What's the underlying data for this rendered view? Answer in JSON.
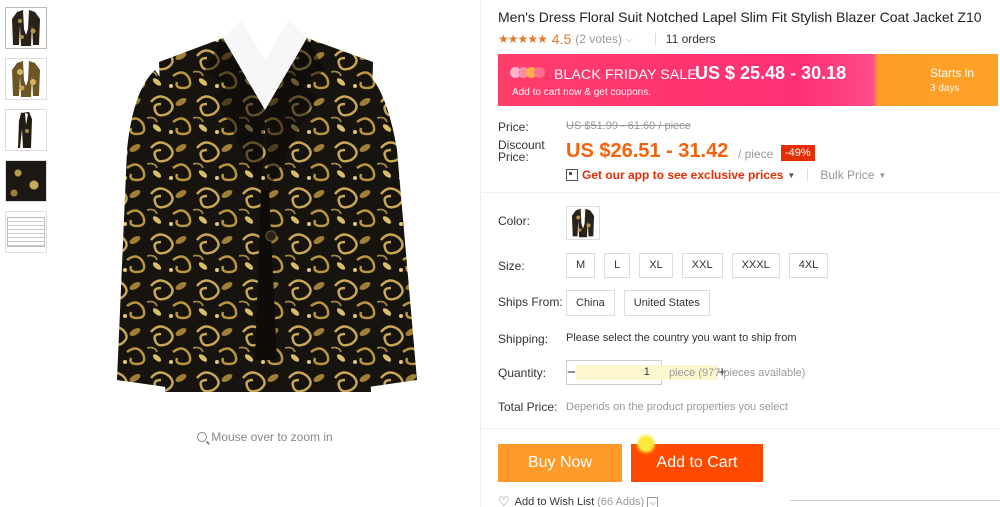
{
  "product": {
    "title": "Men's Dress Floral Suit Notched Lapel Slim Fit Stylish Blazer Coat Jacket Z10",
    "stars": "★★★★★",
    "rating": "4.5",
    "votes": "(2 votes)",
    "orders": "11 orders"
  },
  "promo": {
    "event": "BLACK FRIDAY SALE",
    "range": "US $ 25.48 - 30.18",
    "sub": "Add to cart now & get coupons.",
    "starts_label": "Starts in",
    "starts_days": "3 days",
    "colors": {
      "pink": "#ff2f74",
      "orange": "#ffa22a"
    }
  },
  "pricing": {
    "price_label": "Price:",
    "old_price": "US $51.99 - 61.60 / piece",
    "discount_label_1": "Discount",
    "discount_label_2": "Price:",
    "discount_price": "US $26.51 - 31.42",
    "per": "/ piece",
    "discount_badge": "-49%",
    "app_link": "Get our app to see exclusive prices",
    "bulk": "Bulk Price"
  },
  "options": {
    "color_label": "Color:",
    "size_label": "Size:",
    "sizes": [
      "M",
      "L",
      "XL",
      "XXL",
      "XXXL",
      "4XL"
    ],
    "ships_label": "Ships From:",
    "ships_from": [
      "China",
      "United States"
    ],
    "shipping_label": "Shipping:",
    "shipping_text": "Please select the country you want to ship from",
    "quantity_label": "Quantity:",
    "quantity_value": "1",
    "minus": "−",
    "plus": "+",
    "quantity_note": "piece (977 pieces available)",
    "total_label": "Total Price:",
    "total_note": "Depends on the product properties you select"
  },
  "actions": {
    "buy_now": "Buy Now",
    "add_to_cart": "Add to Cart",
    "wishlist": "Add to Wish List",
    "wishlist_count": "(66 Adds)"
  },
  "gallery": {
    "zoom_hint": "Mouse over to zoom in",
    "thumbs": [
      "jacket-front",
      "jacket-front-gold",
      "jacket-side",
      "fabric-closeup",
      "size-chart"
    ]
  },
  "colors": {
    "accent_orange": "#f4620a",
    "buy_now_bg": "#ff9a2a",
    "add_cart_bg": "#ff4a00",
    "badge_red": "#e62e04",
    "star_orange": "#e27a2e"
  }
}
